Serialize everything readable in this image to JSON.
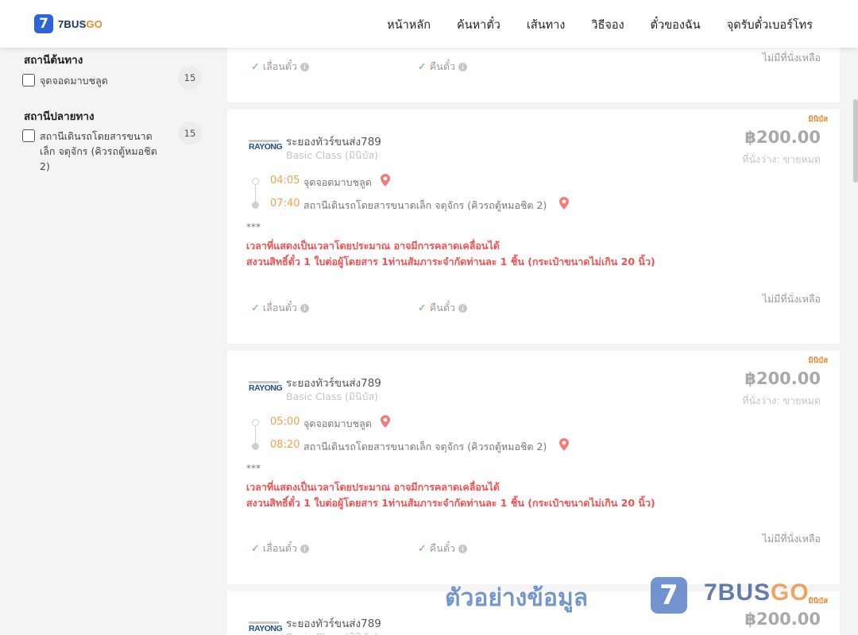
{
  "header": {
    "logo_mark": "7",
    "logo_text_main": "7BUS",
    "logo_text_accent": "GO",
    "nav": [
      "หน้าหลัก",
      "ค้นหาตั๋ว",
      "เส้นทาง",
      "วิธีจอง",
      "ตั๋วของฉัน",
      "จุดรับตั๋วเบอร์โทร"
    ]
  },
  "sidebar": {
    "origin_title": "สถานีต้นทาง",
    "origin_options": [
      {
        "label": "จุดจอดมาบชลูด",
        "count": "15"
      }
    ],
    "dest_title": "สถานีปลายทาง",
    "dest_options": [
      {
        "label": "สถานีเดินรถโดยสารขนาดเล็ก จตุจักร (คิวรถตู้หมอชิต 2)",
        "count": "15"
      }
    ]
  },
  "top_card": {
    "change_ticket": "เลื่อนตั๋ว",
    "refund_ticket": "คืนตั๋ว",
    "no_seat": "ไม่มีที่นั่งเหลือ"
  },
  "trips": [
    {
      "bus_type": "มินิบัส",
      "operator_logo": "RAYONG",
      "operator": "ระยองทัวร์ขนส่ง789",
      "class": "Basic Class (มินิบัส)",
      "price": "฿200.00",
      "seats": "ที่นั่งว่าง: ขายหมด",
      "dep_time": "04:05",
      "dep_stop": "จุดจอดมาบชลูด",
      "arr_time": "07:40",
      "arr_stop": "สถานีเดินรถโดยสารขนาดเล็ก จตุจักร (คิวรถตู้หมอชิต 2)",
      "stars": "***",
      "warn1": "เวลาที่แสดงเป็นเวลาโดยประมาณ อาจมีการคลาดเคลื่อนได้",
      "warn2": "สงวนสิทธิ์ตั๋ว 1 ใบต่อผู้โดยสาร 1ท่านสัมภาระจำกัดท่านละ 1 ชิ้น (กระเป๋าขนาดไม่เกิน 20 นิ้ว)",
      "change_ticket": "เลื่อนตั๋ว",
      "refund_ticket": "คืนตั๋ว",
      "no_seat": "ไม่มีที่นั่งเหลือ"
    },
    {
      "bus_type": "มินิบัส",
      "operator_logo": "RAYONG",
      "operator": "ระยองทัวร์ขนส่ง789",
      "class": "Basic Class (มินิบัส)",
      "price": "฿200.00",
      "seats": "ที่นั่งว่าง: ขายหมด",
      "dep_time": "05:00",
      "dep_stop": "จุดจอดมาบชลูด",
      "arr_time": "08:20",
      "arr_stop": "สถานีเดินรถโดยสารขนาดเล็ก จตุจักร (คิวรถตู้หมอชิต 2)",
      "stars": "***",
      "warn1": "เวลาที่แสดงเป็นเวลาโดยประมาณ อาจมีการคลาดเคลื่อนได้",
      "warn2": "สงวนสิทธิ์ตั๋ว 1 ใบต่อผู้โดยสาร 1ท่านสัมภาระจำกัดท่านละ 1 ชิ้น (กระเป๋าขนาดไม่เกิน 20 นิ้ว)",
      "change_ticket": "เลื่อนตั๋ว",
      "refund_ticket": "คืนตั๋ว",
      "no_seat": "ไม่มีที่นั่งเหลือ"
    },
    {
      "bus_type": "มินิบัส",
      "operator_logo": "RAYONG",
      "operator": "ระยองทัวร์ขนส่ง789",
      "class": "Basic Class (มินิบัส)",
      "price": "฿200.00"
    }
  ],
  "watermark": {
    "text": "ตัวอย่างข้อมูล",
    "mark": "7",
    "word_main": "7BUS",
    "word_accent": "GO"
  }
}
